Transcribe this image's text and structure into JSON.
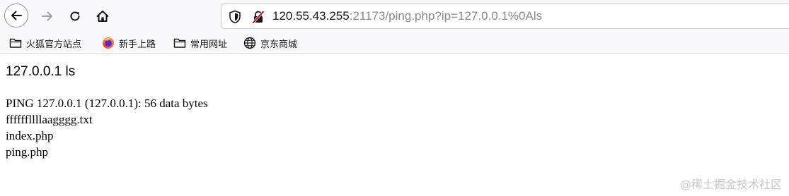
{
  "toolbar": {
    "back_icon": "arrow-left-icon",
    "forward_icon": "arrow-right-icon",
    "reload_icon": "reload-icon",
    "home_icon": "home-icon"
  },
  "urlbar": {
    "shield_icon": "tracking-shield-icon",
    "insecure_icon": "insecure-lock-icon",
    "host": "120.55.43.255",
    "rest": ":21173/ping.php?ip=127.0.0.1%0Als"
  },
  "bookmarks": [
    {
      "label": "火狐官方站点",
      "icon": "folder-icon"
    },
    {
      "label": "新手上路",
      "icon": "firefox-icon"
    },
    {
      "label": "常用网址",
      "icon": "folder-icon"
    },
    {
      "label": "京东商城",
      "icon": "globe-icon"
    }
  ],
  "page": {
    "heading": "127.0.0.1 ls",
    "output_lines": [
      "PING 127.0.0.1 (127.0.0.1): 56 data bytes",
      "ffffffllllaagggg.txt",
      "index.php",
      "ping.php"
    ]
  },
  "watermark": "@稀土掘金技术社区",
  "colors": {
    "toolbar_bg": "#f9f9fb",
    "url_host": "#15141a",
    "url_rest": "#8a8a8a",
    "insecure_red": "#d70022"
  }
}
